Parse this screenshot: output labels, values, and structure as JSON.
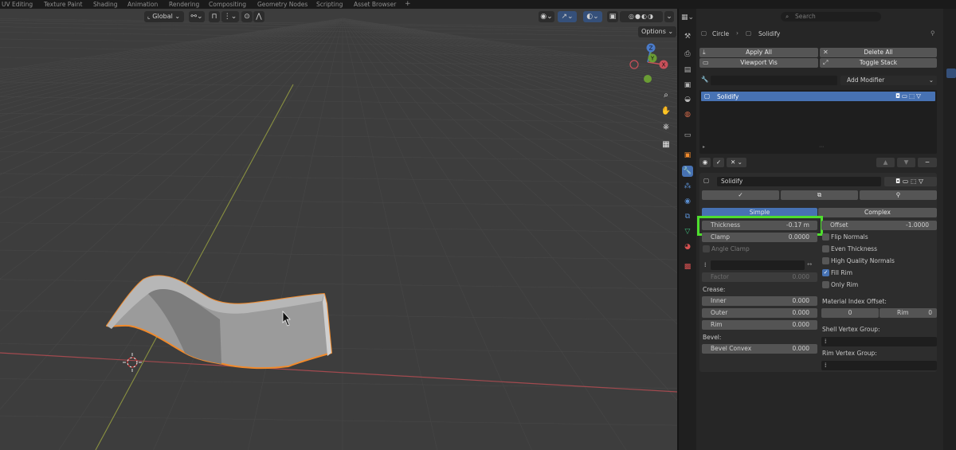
{
  "workspace_tabs": [
    "UV Editing",
    "Texture Paint",
    "Shading",
    "Animation",
    "Rendering",
    "Compositing",
    "Geometry Nodes",
    "Scripting",
    "Asset Browser",
    "+"
  ],
  "viewport": {
    "orientation_label": "Global",
    "options_label": "Options",
    "gizmo": {
      "x": "X",
      "y": "Y",
      "z": "Z"
    },
    "nav_icons": [
      "zoom-icon",
      "hand-pan-icon",
      "camera-icon",
      "grid-icon"
    ]
  },
  "colors": {
    "viewport_bg": "#3d3d3d",
    "grid_line": "#474747",
    "x_axis": "#a24a4f",
    "y_axis": "#899040",
    "selection_outline": "#f08a2c",
    "active_blue": "#4772b3",
    "highlight_box": "#4ede2e"
  },
  "properties": {
    "search_placeholder": "Search",
    "breadcrumb": {
      "object": "Circle",
      "separator": "›",
      "modifier": "Solidify"
    },
    "apply_all": "Apply All",
    "delete_all": "Delete All",
    "viewport_vis": "Viewport Vis",
    "toggle_stack": "Toggle Stack",
    "add_modifier": "Add Modifier",
    "modifier_list": [
      {
        "name": "Solidify"
      }
    ],
    "modifier_name": "Solidify",
    "mode_simple": "Simple",
    "mode_complex": "Complex",
    "thickness_label": "Thickness",
    "thickness_value": "-0.17 m",
    "offset_label": "Offset",
    "offset_value": "-1.0000",
    "clamp_label": "Clamp",
    "clamp_value": "0.0000",
    "angle_clamp_label": "Angle Clamp",
    "factor_label": "Factor",
    "factor_value": "0.000",
    "flip_normals": "Flip Normals",
    "even_thickness": "Even Thickness",
    "high_quality_normals": "High Quality Normals",
    "fill_rim": "Fill Rim",
    "fill_rim_checked": true,
    "only_rim": "Only Rim",
    "crease_label": "Crease:",
    "crease_inner_label": "Inner",
    "crease_inner_value": "0.000",
    "crease_outer_label": "Outer",
    "crease_outer_value": "0.000",
    "crease_rim_label": "Rim",
    "crease_rim_value": "0.000",
    "material_index_offset_label": "Material Index Offset:",
    "material_index_value": "0",
    "material_rim_label": "Rim",
    "material_rim_value": "0",
    "bevel_label": "Bevel:",
    "bevel_convex_label": "Bevel Convex",
    "bevel_convex_value": "0.000",
    "shell_vertex_group_label": "Shell Vertex Group:",
    "rim_vertex_group_label": "Rim Vertex Group:"
  }
}
